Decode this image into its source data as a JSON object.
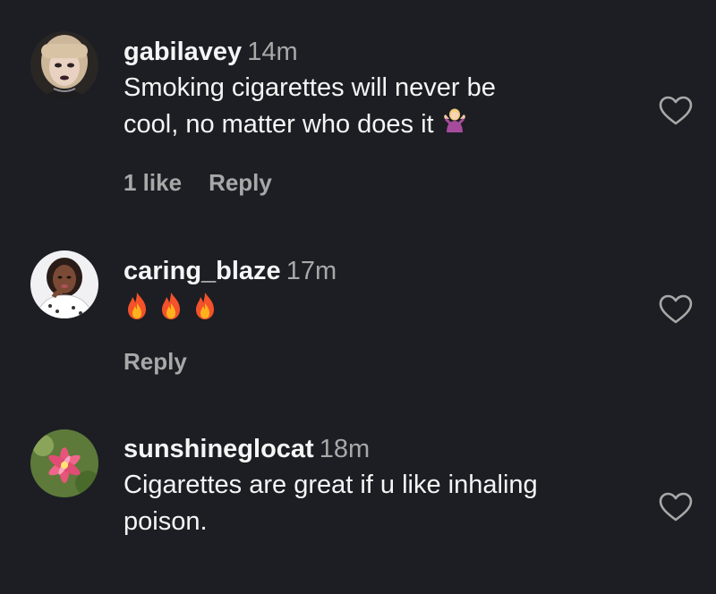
{
  "comments": [
    {
      "username": "gabilavey",
      "time": "14m",
      "text_line1": "Smoking cigarettes will never be",
      "text_line2": "cool, no matter who does it",
      "likes": "1 like",
      "reply": "Reply",
      "avatar_icon": "avatar-photo-woman-dark-lipstick"
    },
    {
      "username": "caring_blaze",
      "time": "17m",
      "reply": "Reply",
      "emoji_icons": [
        "fire-emoji",
        "fire-emoji",
        "fire-emoji"
      ],
      "avatar_icon": "avatar-photo-woman-white-top"
    },
    {
      "username": "sunshineglocat",
      "time": "18m",
      "text_line1": "Cigarettes are great if u like inhaling",
      "text_line2": "poison.",
      "avatar_icon": "avatar-photo-pink-lily"
    }
  ],
  "colors": {
    "background": "#1c1e23",
    "primary_text": "#f5f5f5",
    "secondary_text": "#a8a8a8"
  },
  "icons": {
    "like": "heart-outline-icon",
    "shrug": "woman-shrugging-emoji",
    "fire": "fire-emoji"
  }
}
